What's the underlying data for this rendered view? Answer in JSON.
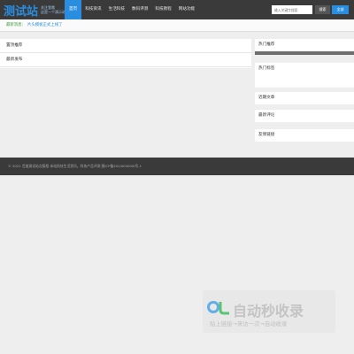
{
  "header": {
    "logo": {
      "main": "测试站",
      "sub_line1": "关注我哦",
      "sub_line2": "这是一个演示站点"
    },
    "nav": [
      "首页",
      "科技资讯",
      "生活科技",
      "数码评测",
      "科技教程",
      "网站功能"
    ],
    "search": {
      "placeholder": "输入关键字搜索",
      "button": "搜索",
      "region": "全部"
    }
  },
  "notice": {
    "label": "最新消息：",
    "text": "片头模板正式上线了"
  },
  "main": {
    "rows": [
      "置顶推荐",
      "最新发布"
    ]
  },
  "sidebar": {
    "boxes": [
      "热门推荐",
      "热门标签",
      "近期文章",
      "最新评论",
      "友情链接"
    ]
  },
  "footer": {
    "text": "© 2021 百度测试站点版权·本站科技生活资讯，科技产品评测   图ICP备2024000000号-1"
  },
  "watermark": {
    "main": "自动秒收录",
    "sub": "贴上链接→来访一次→自动收录"
  },
  "colors": {
    "header_bg": "#3a3a3a",
    "accent": "#2a8ee0",
    "notice_label": "#3a9b3a"
  }
}
